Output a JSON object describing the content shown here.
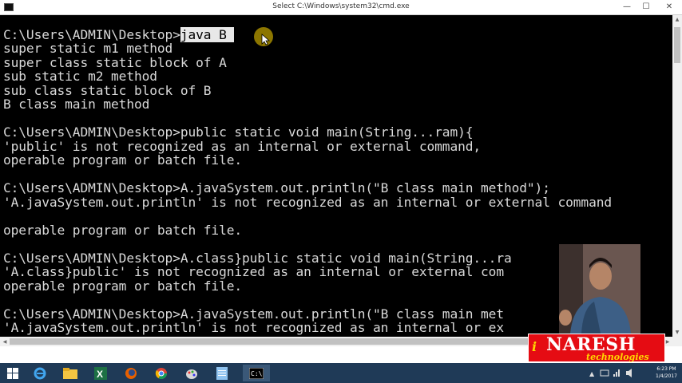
{
  "window": {
    "title": "Select C:\\Windows\\system32\\cmd.exe",
    "minimize_glyph": "—",
    "maximize_glyph": "☐",
    "close_glyph": "✕"
  },
  "console": {
    "lines": [
      {
        "pre": "C:\\Users\\ADMIN\\Desktop>",
        "sel": "java B ",
        "post": ""
      },
      {
        "pre": "super static m1 method"
      },
      {
        "pre": "super class static block of A"
      },
      {
        "pre": "sub static m2 method"
      },
      {
        "pre": "sub class static block of B"
      },
      {
        "pre": "B class main method"
      },
      {
        "pre": ""
      },
      {
        "pre": "C:\\Users\\ADMIN\\Desktop>public static void main(String...ram){"
      },
      {
        "pre": "'public' is not recognized as an internal or external command,"
      },
      {
        "pre": "operable program or batch file."
      },
      {
        "pre": ""
      },
      {
        "pre": "C:\\Users\\ADMIN\\Desktop>A.javaSystem.out.println(\"B class main method\");"
      },
      {
        "pre": "'A.javaSystem.out.println' is not recognized as an internal or external command"
      },
      {
        "pre": ""
      },
      {
        "pre": "operable program or batch file."
      },
      {
        "pre": ""
      },
      {
        "pre": "C:\\Users\\ADMIN\\Desktop>A.class}public static void main(String...ra"
      },
      {
        "pre": "'A.class}public' is not recognized as an internal or external com"
      },
      {
        "pre": "operable program or batch file."
      },
      {
        "pre": ""
      },
      {
        "pre": "C:\\Users\\ADMIN\\Desktop>A.javaSystem.out.println(\"B class main met"
      },
      {
        "pre": "'A.javaSystem.out.println' is not recognized as an internal or ex          mand"
      }
    ]
  },
  "taskbar": {
    "apps": [
      "start-icon",
      "internet-explorer-icon",
      "file-explorer-icon",
      "excel-icon",
      "firefox-icon",
      "chrome-icon",
      "paint-icon",
      "notepad-icon",
      "command-prompt-icon"
    ],
    "clock_time": "6:23 PM",
    "clock_date": "1/4/2017"
  },
  "brand": {
    "name": "NARESH",
    "tagline": "technologies",
    "mark": "i"
  },
  "colors": {
    "console_bg": "#000000",
    "console_text": "#d9d9d9",
    "selection_bg": "#e8e8e8",
    "taskbar_bg": "#1f3a57",
    "brand_red": "#e50c13",
    "brand_gold": "#ffd700"
  }
}
